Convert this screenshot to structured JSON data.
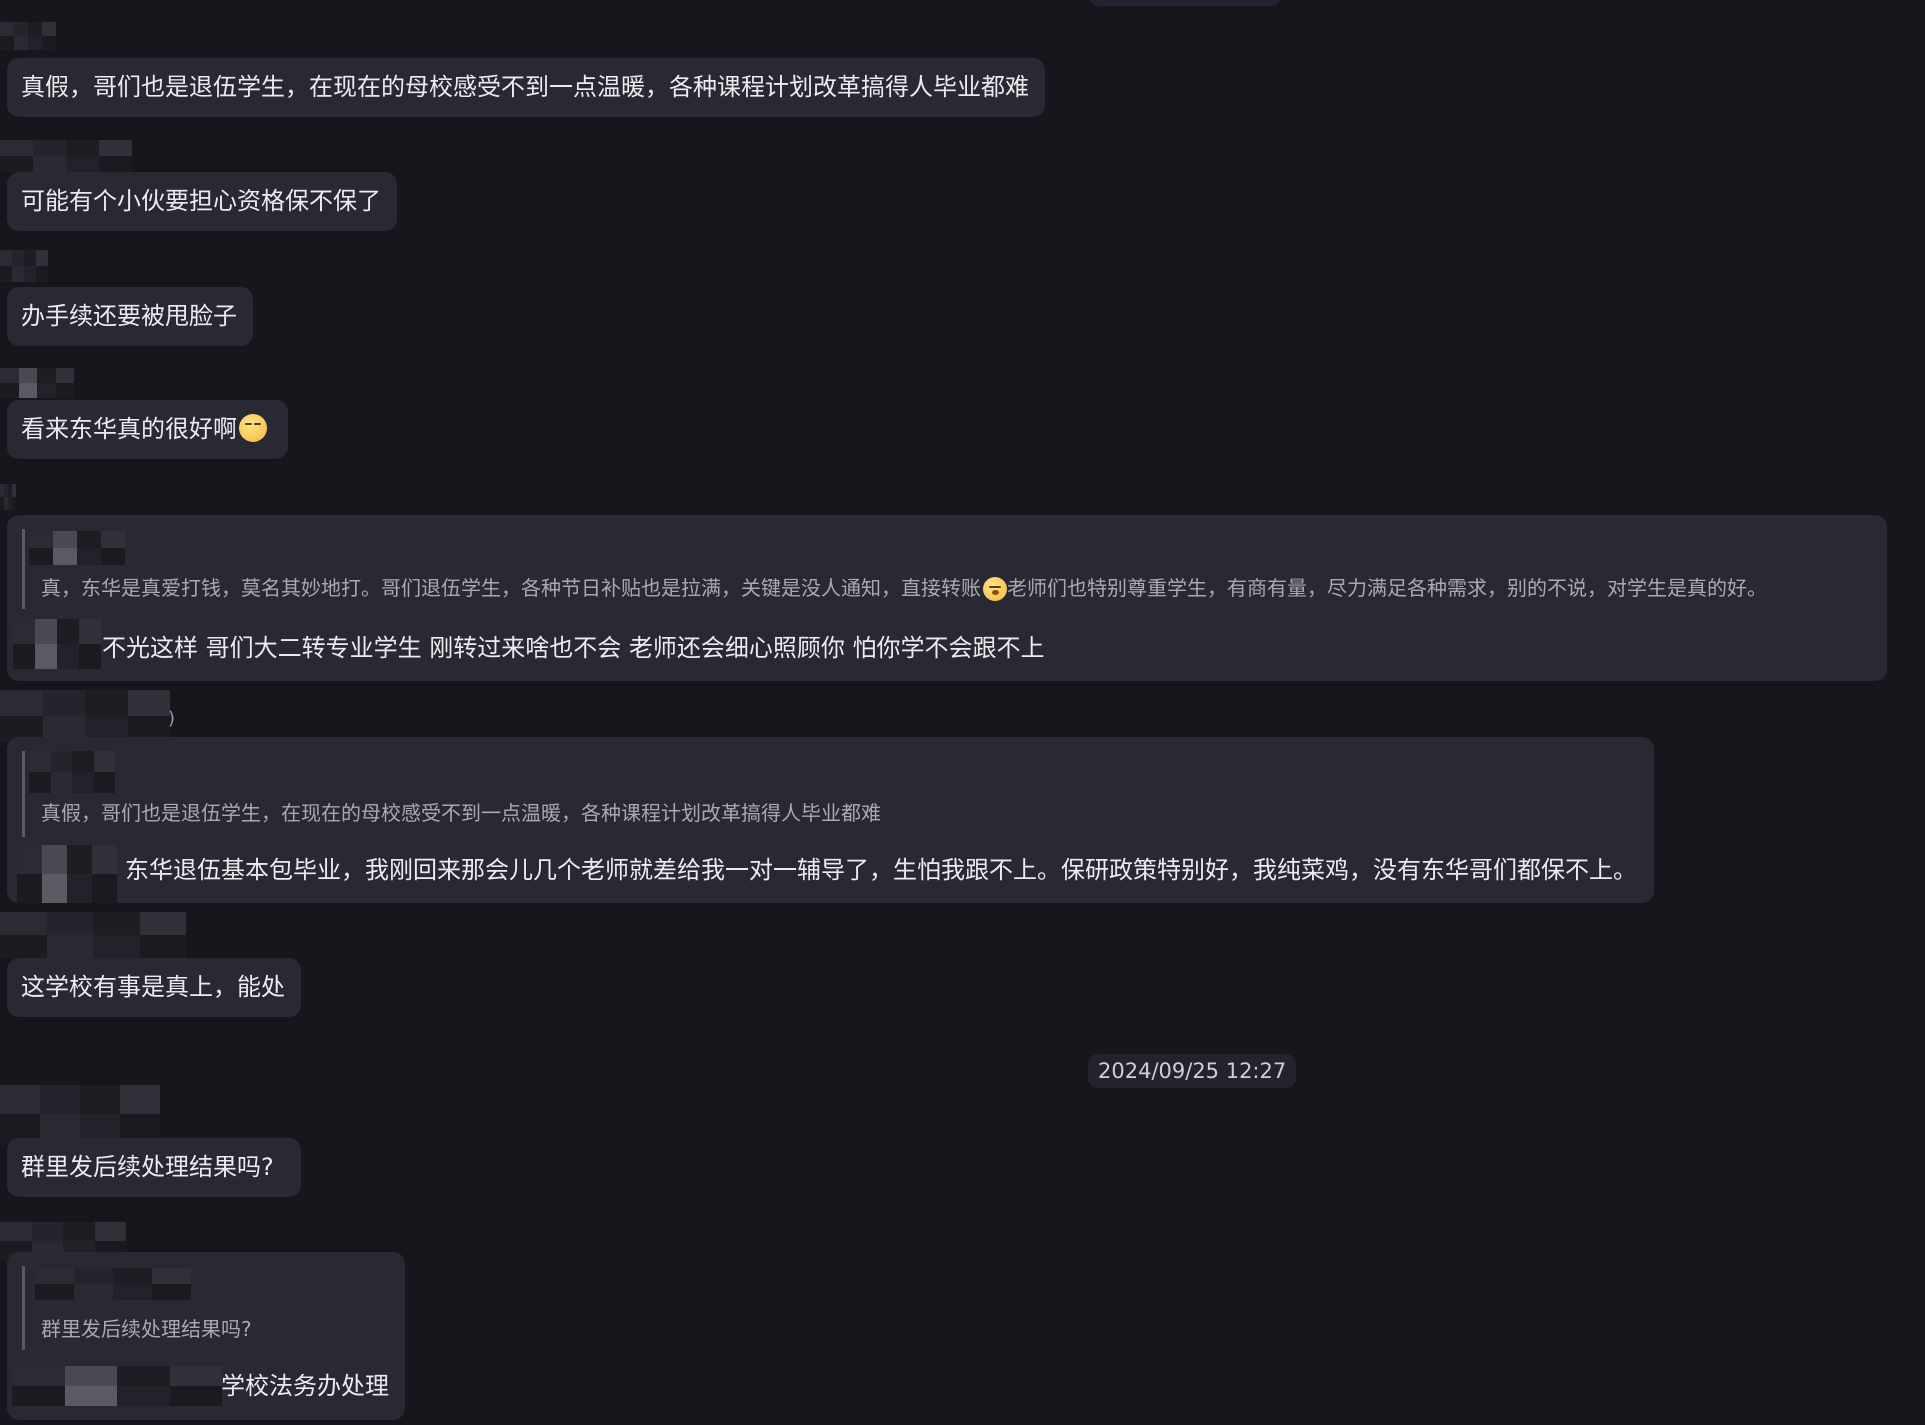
{
  "messages": [
    {
      "text": "真假，哥们也是退伍学生，在现在的母校感受不到一点温暖，各种课程计划改革搞得人毕业都难"
    },
    {
      "text": "可能有个小伙要担心资格保不保了"
    },
    {
      "text": "办手续还要被甩脸子"
    },
    {
      "text": "看来东华真的很好啊",
      "emoji": "smirk-face-emoji"
    },
    {
      "quote": "真，东华是真爱打钱，莫名其妙地打。哥们退伍学生，各种节日补贴也是拉满，关键是没人通知，直接转账",
      "quote_emoji": "kiss-face-emoji",
      "quote_tail": "老师们也特别尊重学生，有商有量，尽力满足各种需求，别的不说，对学生是真的好。",
      "text": "不光这样 哥们大二转专业学生 刚转过来啥也不会 老师还会细心照顾你 怕你学不会跟不上"
    },
    {
      "sender_suffix": ")",
      "quote": "真假，哥们也是退伍学生，在现在的母校感受不到一点温暖，各种课程计划改革搞得人毕业都难",
      "text": "东华退伍基本包毕业，我刚回来那会儿几个老师就差给我一对一辅导了，生怕我跟不上。保研政策特别好，我纯菜鸡，没有东华哥们都保不上。"
    },
    {
      "text": "这学校有事是真上，能处"
    },
    {
      "timestamp": "2024/09/25 12:27"
    },
    {
      "text": "群里发后续处理结果吗?"
    },
    {
      "quote": "群里发后续处理结果吗?",
      "text": "学校法务办处理"
    }
  ]
}
